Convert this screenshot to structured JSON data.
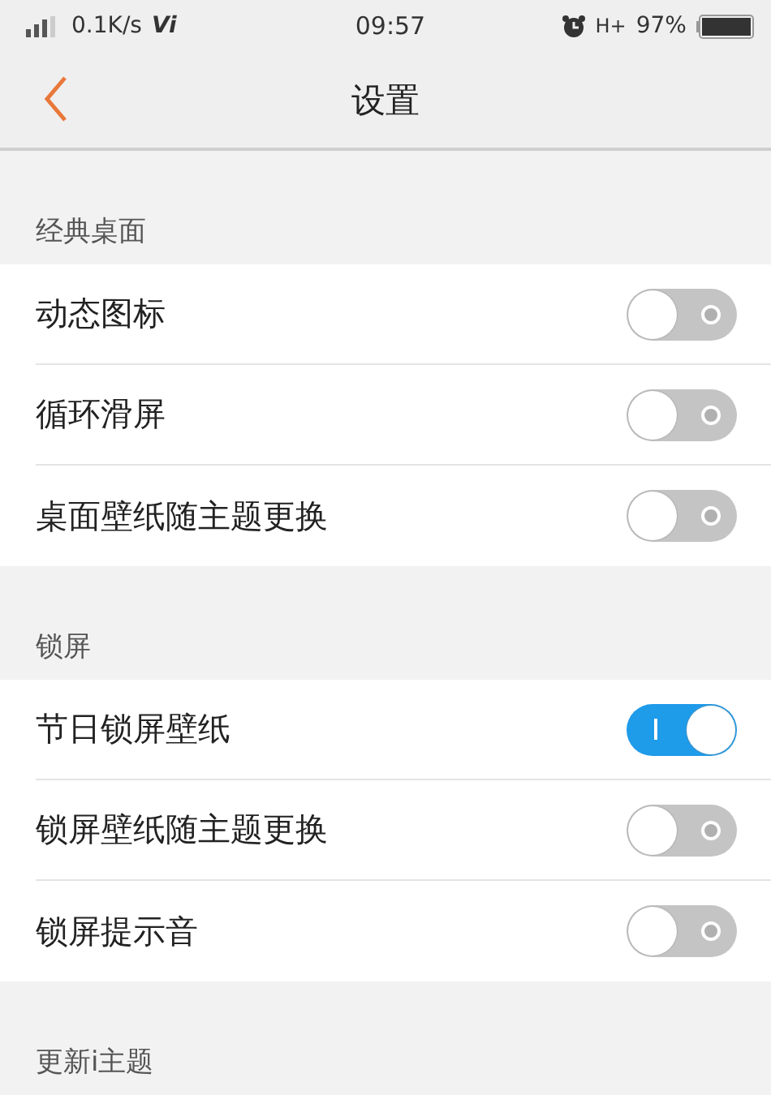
{
  "status_bar": {
    "speed": "0.1K/s",
    "carrier_logo": "Vi",
    "time": "09:57",
    "network": "H+",
    "battery": "97%"
  },
  "header": {
    "title": "设置"
  },
  "sections": [
    {
      "title": "经典桌面",
      "items": [
        {
          "label": "动态图标",
          "on": false
        },
        {
          "label": "循环滑屏",
          "on": false
        },
        {
          "label": "桌面壁纸随主题更换",
          "on": false
        }
      ]
    },
    {
      "title": "锁屏",
      "items": [
        {
          "label": "节日锁屏壁纸",
          "on": true
        },
        {
          "label": "锁屏壁纸随主题更换",
          "on": false
        },
        {
          "label": "锁屏提示音",
          "on": false
        }
      ]
    },
    {
      "title": "更新i主题"
    }
  ]
}
